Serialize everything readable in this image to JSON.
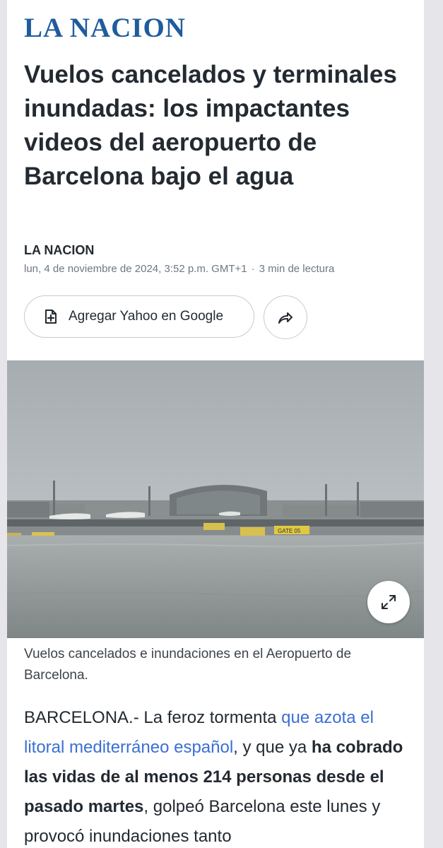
{
  "header": {
    "logo_text": "LA NACION"
  },
  "article": {
    "headline": "Vuelos cancelados y terminales inundadas: los impactantes videos del aeropuerto de Barcelona bajo el agua",
    "source": "LA NACION",
    "date": "lun, 4 de noviembre de 2024, 3:52 p.m. GMT+1",
    "separator": "·",
    "read_time": "3 min de lectura"
  },
  "actions": {
    "add_google_label": "Agregar Yahoo en Google",
    "add_google_icon": "add-document-icon",
    "share_icon": "share-arrow-icon"
  },
  "media": {
    "caption": "Vuelos cancelados e inundaciones en el Aeropuerto de Barcelona.",
    "expand_icon": "expand-arrows-icon",
    "signs": [
      "GATE 05"
    ]
  },
  "body": {
    "p1_lead": "BARCELONA.- La feroz tormenta ",
    "p1_link": "que azota el litoral mediterráneo español",
    "p1_mid": ", y que ya ",
    "p1_bold": "ha cobrado las vidas de al menos 214 personas desde el pasado martes",
    "p1_tail": ", golpeó Barcelona este lunes y provocó inundaciones tanto"
  },
  "colors": {
    "logo": "#1f5c9c",
    "link": "#3b6fd4",
    "text": "#232a31",
    "meta": "#6e7780"
  }
}
